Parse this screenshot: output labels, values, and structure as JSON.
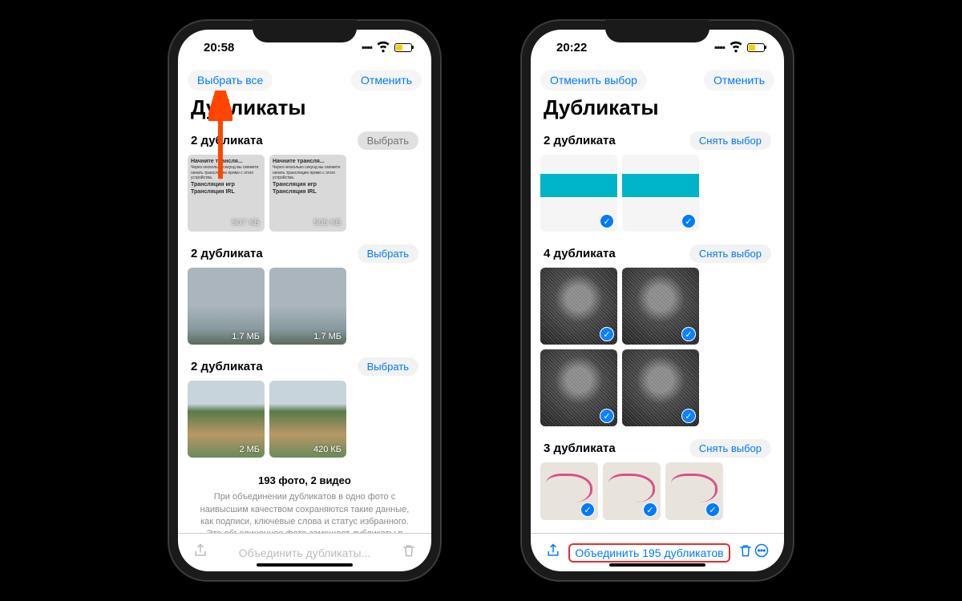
{
  "phone1": {
    "time": "20:58",
    "nav_left": "Выбрать все",
    "nav_right": "Отменить",
    "title": "Дубликаты",
    "groups": [
      {
        "title": "2 дубликата",
        "button": "Выбрать",
        "thumbs": [
          {
            "title": "Начните трансля...",
            "sub": "Трансляция игр",
            "foot": "Трансляция IRL",
            "size": "507 КБ"
          },
          {
            "title": "Начните трансля...",
            "sub": "Трансляция игр",
            "foot": "Трансляция IRL",
            "size": "505 КБ"
          }
        ]
      },
      {
        "title": "2 дубликата",
        "button": "Выбрать",
        "thumbs": [
          {
            "size": "1.7 МБ"
          },
          {
            "size": "1.7 МБ"
          }
        ]
      },
      {
        "title": "2 дубликата",
        "button": "Выбрать",
        "thumbs": [
          {
            "size": "2 МБ"
          },
          {
            "size": "420 КБ"
          }
        ]
      }
    ],
    "summary_counts": "193 фото, 2 видео",
    "summary_text": "При объединении дубликатов в одно фото с наивысшим качеством сохраняются такие данные, как подписи, ключевые слова и статус избранного. Это объединенное фото замещает дубликаты в альбомах.",
    "toolbar_center": "Объединить дубликаты..."
  },
  "phone2": {
    "time": "20:22",
    "nav_left": "Отменить выбор",
    "nav_right": "Отменить",
    "title": "Дубликаты",
    "groups": [
      {
        "title": "2 дубликата",
        "button": "Снять выбор"
      },
      {
        "title": "4 дубликата",
        "button": "Снять выбор"
      },
      {
        "title": "3 дубликата",
        "button": "Снять выбор"
      }
    ],
    "toolbar_center": "Объединить 195 дубликатов"
  },
  "battery_pct": 40
}
